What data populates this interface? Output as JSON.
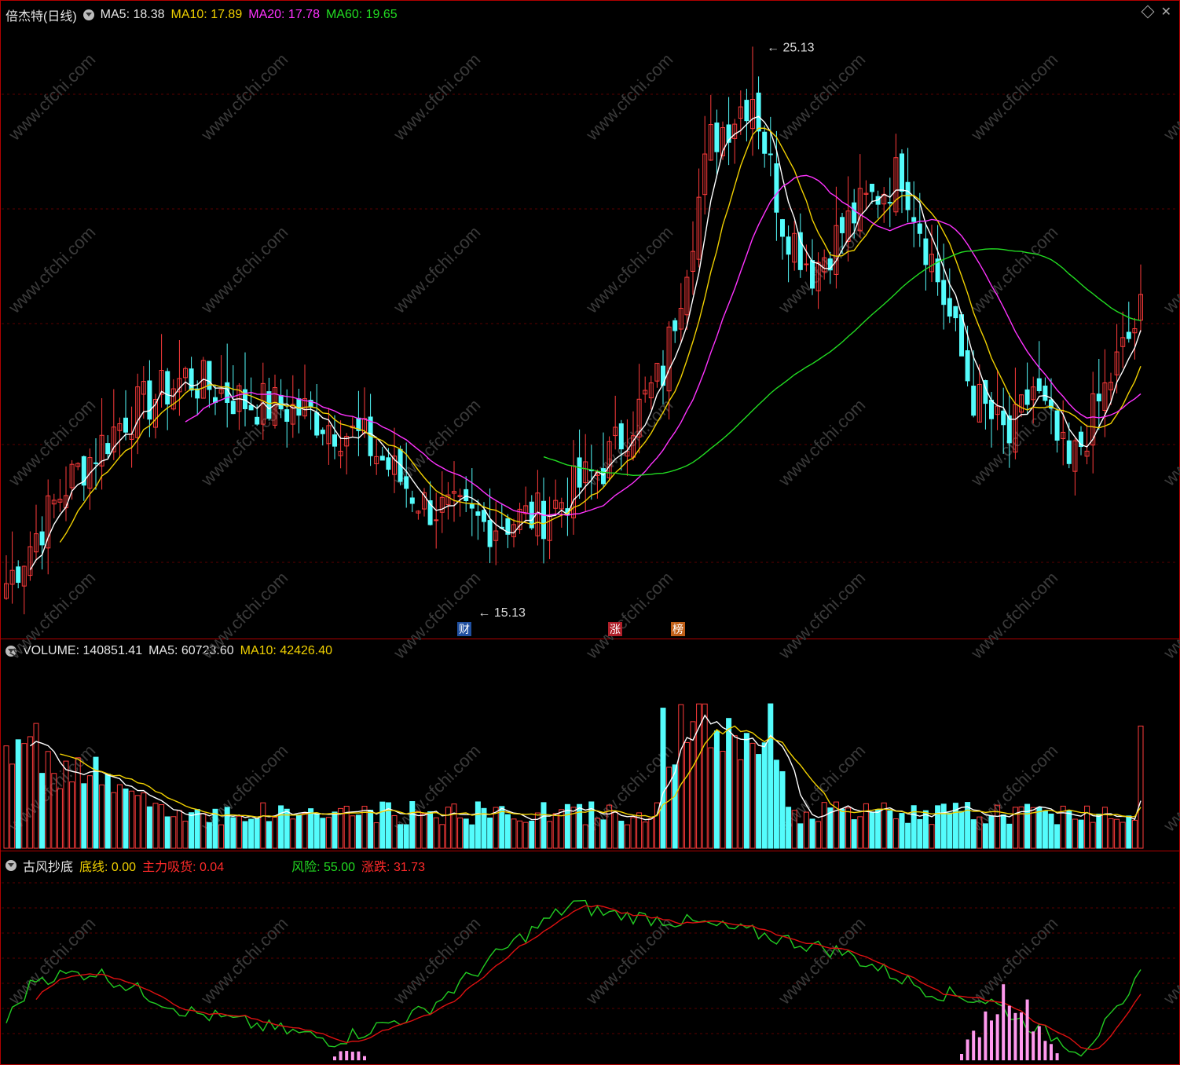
{
  "price_panel": {
    "title": "倍杰特(日线)",
    "ma5_label": "MA5: 18.38",
    "ma10_label": "MA10: 17.89",
    "ma20_label": "MA20: 17.78",
    "ma60_label": "MA60: 19.65",
    "high_label": "25.13",
    "low_label": "15.13",
    "badges": [
      "财",
      "涨",
      "榜"
    ]
  },
  "volume_panel": {
    "volume_label": "VOLUME: 140851.41",
    "ma5_label": "MA5: 60723.60",
    "ma10_label": "MA10: 42426.40"
  },
  "indicator_panel": {
    "name": "古风抄底",
    "bottom_line_label": "底线: 0.00",
    "main_absorb_label": "主力吸货: 0.04",
    "risk_label": "风险: 55.00",
    "change_label": "涨跌: 31.73"
  },
  "watermark": "www.cfchi.com",
  "colors": {
    "up": "#ff3b3b",
    "down": "#54fcfc",
    "ma5": "#ffffff",
    "ma10": "#f0d000",
    "ma20": "#ff33ff",
    "ma60": "#22dd22",
    "risk": "#22cc22",
    "change": "#dd1111",
    "absorb": "#ff99ee",
    "frame": "#b00000"
  },
  "chart_data": {
    "type": "candlestick",
    "price_high": 25.13,
    "price_low": 15.13,
    "indicator_values": {
      "bottom_line": 0.0,
      "main_absorb": 0.04,
      "risk": 55.0,
      "change": 31.73
    },
    "volume_values": {
      "volume": 140851.41,
      "ma5": 60723.6,
      "ma10": 42426.4
    },
    "ma_values": {
      "ma5": 18.38,
      "ma10": 17.89,
      "ma20": 17.78,
      "ma60": 19.65
    }
  }
}
